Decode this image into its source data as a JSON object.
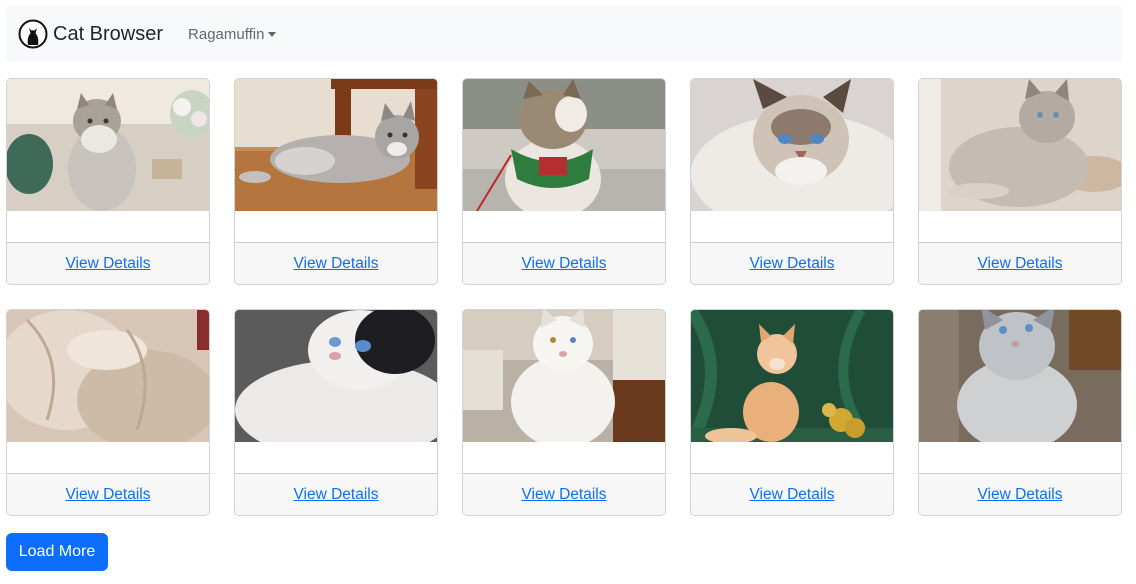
{
  "navbar": {
    "brand": "Cat Browser",
    "breed_dropdown": "Ragamuffin"
  },
  "cards": [
    {
      "link": "View Details",
      "photo": "fluffy gray kitten sitting by flowers"
    },
    {
      "link": "View Details",
      "photo": "gray kitten lying on wood floor"
    },
    {
      "link": "View Details",
      "photo": "tabby cat wearing green harness"
    },
    {
      "link": "View Details",
      "photo": "blue-eyed colorpoint cat close-up"
    },
    {
      "link": "View Details",
      "photo": "gray cat lounging on cushion"
    },
    {
      "link": "View Details",
      "photo": "close-up of cream cat fur"
    },
    {
      "link": "View Details",
      "photo": "black and white cat looking up"
    },
    {
      "link": "View Details",
      "photo": "white long-haired cat sitting"
    },
    {
      "link": "View Details",
      "photo": "orange kitten on green backdrop"
    },
    {
      "link": "View Details",
      "photo": "blue-eyed gray fluffy cat sitting"
    }
  ],
  "load_more": "Load More",
  "colors": {
    "link": "#0d6efd",
    "button": "#0d6efd",
    "navbar_bg": "#f8f9fa",
    "footer_bg": "#f7f7f7"
  }
}
